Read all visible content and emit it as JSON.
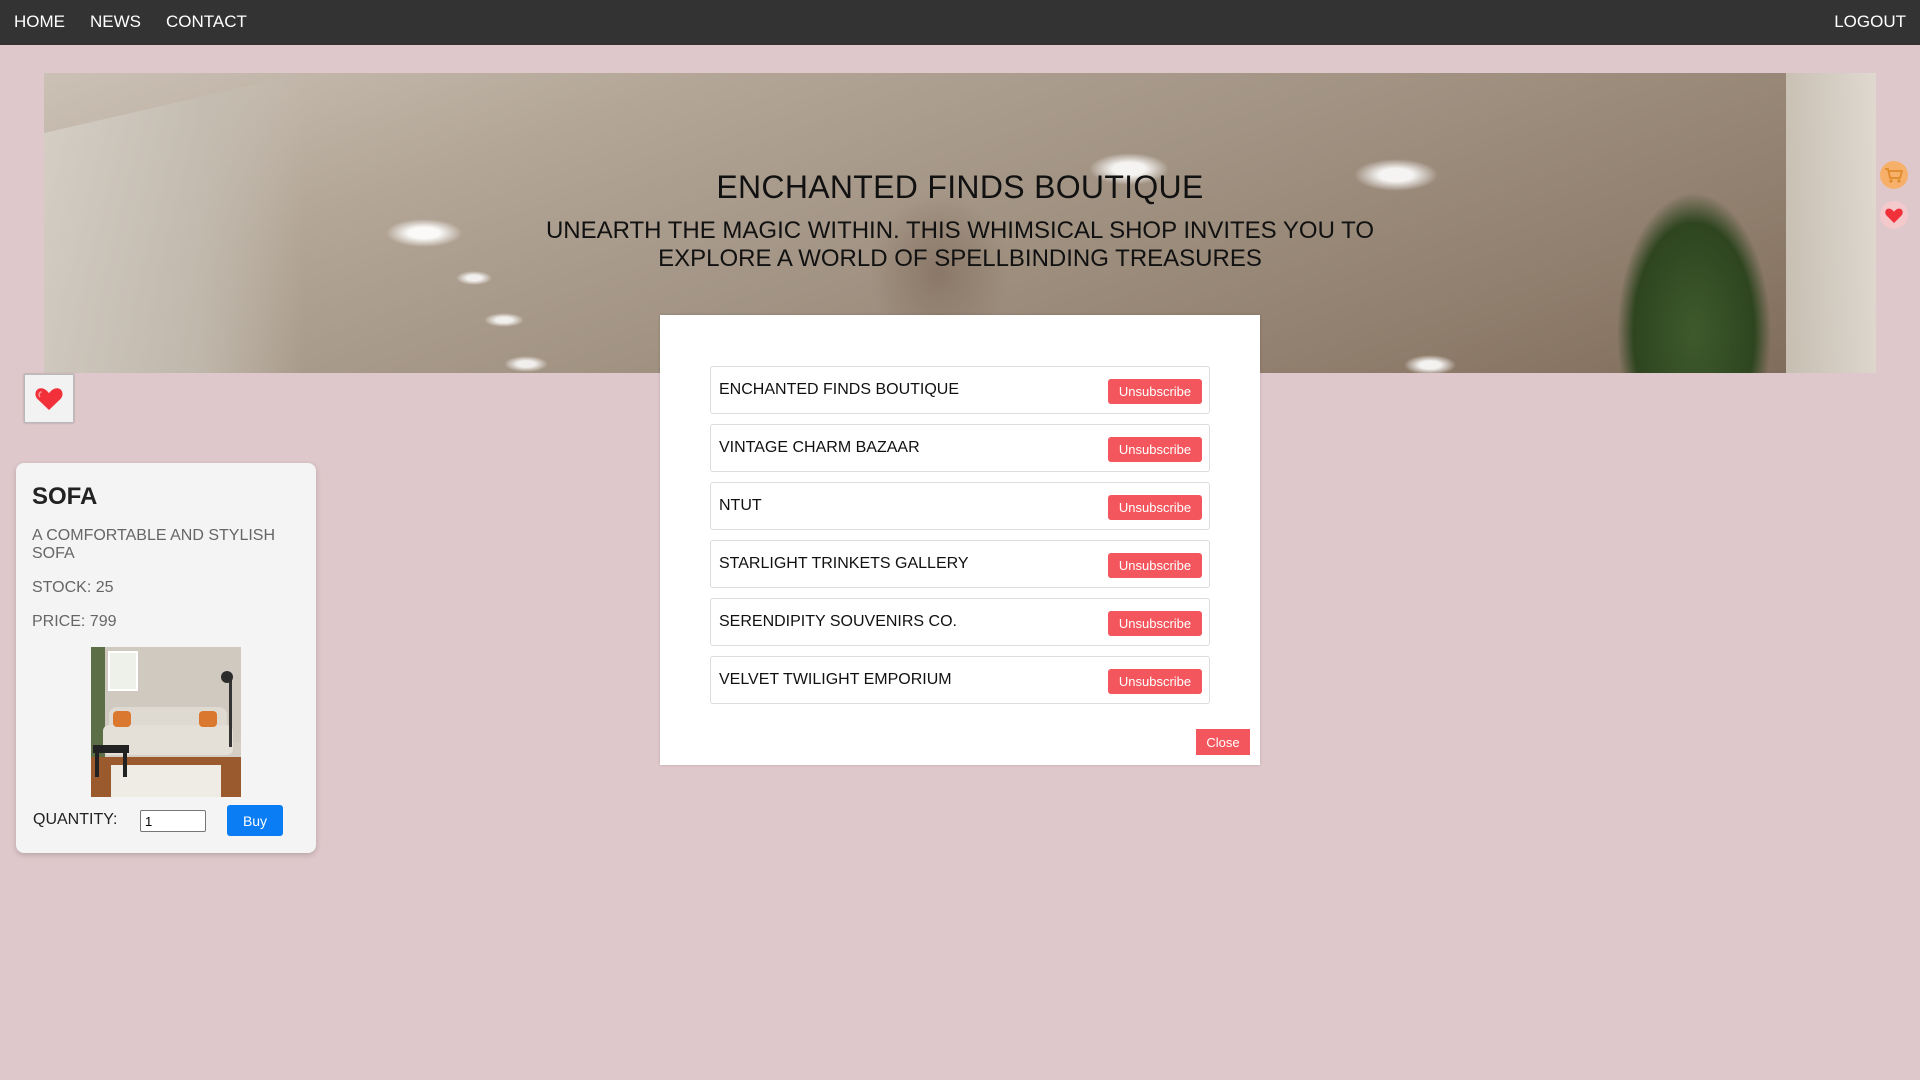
{
  "nav": {
    "home": "HOME",
    "news": "NEWS",
    "contact": "CONTACT",
    "logout": "LOGOUT"
  },
  "hero": {
    "title": "ENCHANTED FINDS BOUTIQUE",
    "subtitle": "UNEARTH THE MAGIC WITHIN. THIS WHIMSICAL SHOP INVITES YOU TO EXPLORE A WORLD OF SPELLBINDING TREASURES"
  },
  "icons": {
    "cart": "cart-icon",
    "heart": "heart-icon"
  },
  "product": {
    "name": "SOFA",
    "description": "A COMFORTABLE AND STYLISH SOFA",
    "stock": "STOCK: 25",
    "price": "PRICE: 799",
    "quantity_label": "QUANTITY:",
    "quantity_value": "1",
    "buy_label": "Buy"
  },
  "modal": {
    "subscriptions": [
      {
        "name": "ENCHANTED FINDS BOUTIQUE",
        "action": "Unsubscribe"
      },
      {
        "name": "VINTAGE CHARM BAZAAR",
        "action": "Unsubscribe"
      },
      {
        "name": "NTUT",
        "action": "Unsubscribe"
      },
      {
        "name": "STARLIGHT TRINKETS GALLERY",
        "action": "Unsubscribe"
      },
      {
        "name": "SERENDIPITY SOUVENIRS CO.",
        "action": "Unsubscribe"
      },
      {
        "name": "VELVET TWILIGHT EMPORIUM",
        "action": "Unsubscribe"
      }
    ],
    "close_label": "Close"
  },
  "colors": {
    "page_bg": "#dfc8cb",
    "nav_bg": "#333333",
    "buy_button": "#0a7df5",
    "danger_button": "#f3565c"
  }
}
